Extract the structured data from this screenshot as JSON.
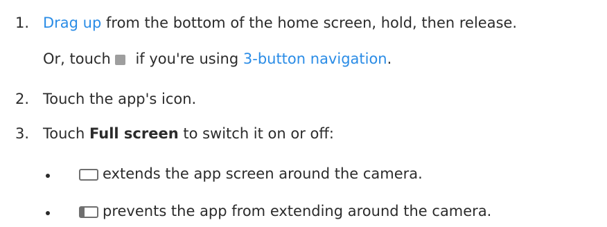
{
  "steps": [
    {
      "num": "1.",
      "link": "Drag up",
      "text": " from the bottom of the home screen, hold, then release."
    },
    {
      "prefix": "Or, touch",
      "middle": " if you're using ",
      "link": "3-button navigation",
      "suffix": "."
    },
    {
      "num": "2.",
      "text": "Touch the app's icon."
    },
    {
      "num": "3.",
      "prefix": "Touch ",
      "bold": "Full screen",
      "suffix": " to switch it on or off:"
    }
  ],
  "bullets": [
    {
      "icon": "rounded-rectangle-icon",
      "text": "extends the app screen around the camera."
    },
    {
      "icon": "rectangle-with-left-bar-icon",
      "text": "prevents the app from extending around the camera."
    }
  ],
  "colors": {
    "link": "#2a8ce6",
    "text": "#2b2b2b",
    "overview_icon": "#9e9e9e"
  },
  "icons": {
    "overview_button": "gray-square-icon"
  }
}
